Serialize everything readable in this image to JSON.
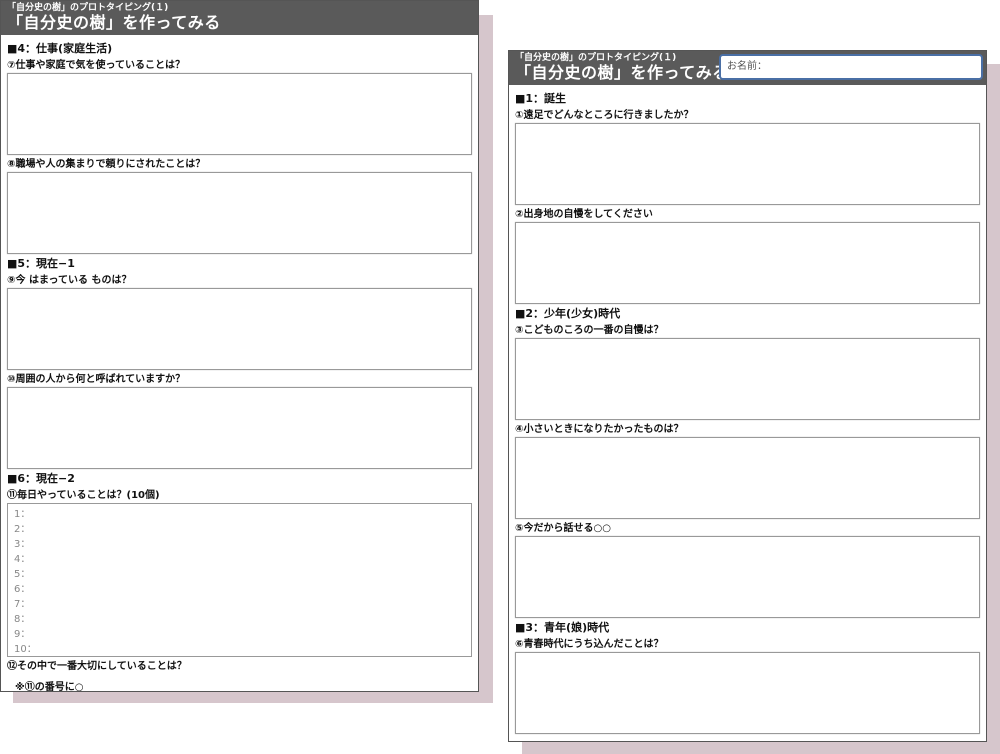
{
  "left_page": {
    "header": {
      "sub_title": "「自分史の樹」のプロトタイピング(１)",
      "main_title": "「自分史の樹」を作ってみる"
    },
    "section4": {
      "title": "■4：仕事(家庭生活)",
      "q7": "⑦仕事や家庭で気を使っていることは？",
      "q8": "⑧職場や人の集まりで頼りにされたことは？"
    },
    "section5": {
      "title": "■5：現在−1",
      "q9": "⑨今 はまっている ものは？",
      "q10": "⑩周囲の人から何と呼ばれていますか？"
    },
    "section6": {
      "title": "■6：現在−2",
      "q11": "⑪毎日やっていることは？(10個)",
      "list": [
        "1：",
        "2：",
        "3：",
        "4：",
        "5：",
        "6：",
        "7：",
        "8：",
        "9：",
        "10："
      ],
      "q12": "⑫その中で一番大切にしていることは？",
      "note": "※⑪の番号に○"
    }
  },
  "right_page": {
    "header": {
      "sub_title": "「自分史の樹」のプロトタイピング(１)",
      "main_title": "「自分史の樹」を作ってみる"
    },
    "name_field": {
      "placeholder": "お名前："
    },
    "section1": {
      "title": "■1：誕生",
      "q1": "①遠足でどんなところに行きましたか？",
      "q2": "②出身地の自慢をしてください"
    },
    "section2": {
      "title": "■2：少年(少女)時代",
      "q3": "③こどものころの一番の自慢は？",
      "q4": "④小さいときになりたかったものは？",
      "q5": "⑤今だから話せる○○"
    },
    "section3": {
      "title": "■3：青年(娘)時代",
      "q6": "⑥青春時代にうち込んだことは？"
    }
  }
}
